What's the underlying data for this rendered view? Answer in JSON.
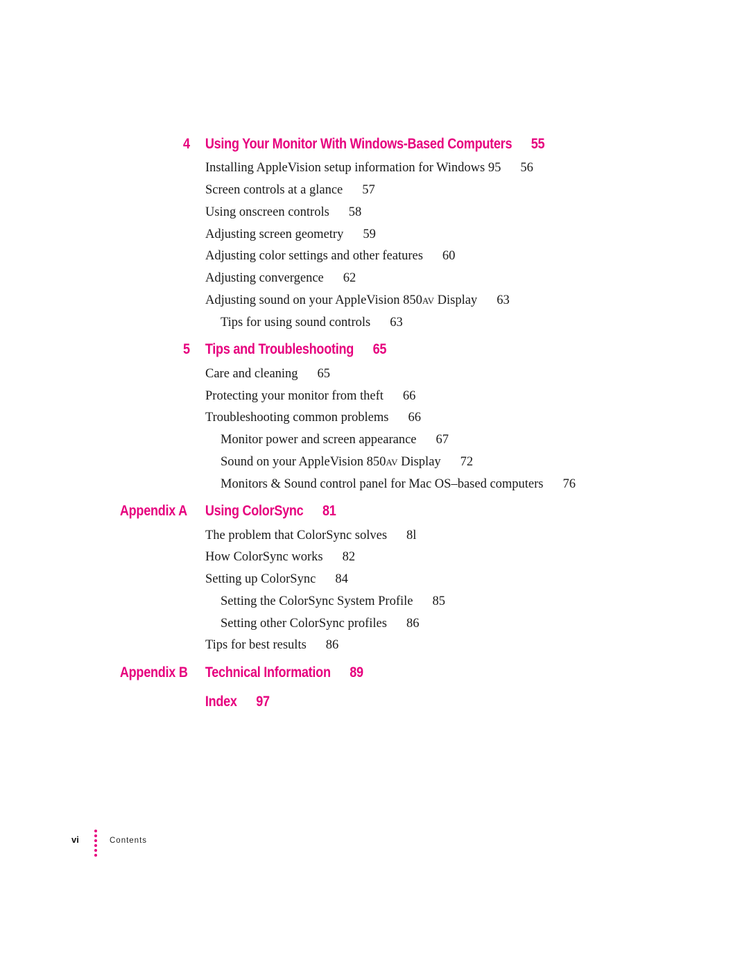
{
  "toc": {
    "ch4": {
      "number": "4",
      "title": "Using Your Monitor With Windows-Based Computers",
      "page": "55",
      "entries": [
        {
          "text": "Installing AppleVision setup information for Windows 95",
          "page": "56"
        },
        {
          "text": "Screen controls at a glance",
          "page": "57"
        },
        {
          "text": "Using onscreen controls",
          "page": "58"
        },
        {
          "text": "Adjusting screen geometry",
          "page": "59"
        },
        {
          "text": "Adjusting color settings and other features",
          "page": "60"
        },
        {
          "text": "Adjusting convergence",
          "page": "62"
        },
        {
          "text_before": "Adjusting sound on your AppleVision 850",
          "smallcaps": "AV",
          "text_after": " Display",
          "page": "63"
        },
        {
          "text": "Tips for using sound controls",
          "page": "63"
        }
      ]
    },
    "ch5": {
      "number": "5",
      "title": "Tips and Troubleshooting",
      "page": "65",
      "entries": [
        {
          "text": "Care and cleaning",
          "page": "65"
        },
        {
          "text": "Protecting your monitor from theft",
          "page": "66"
        },
        {
          "text": "Troubleshooting common problems",
          "page": "66"
        },
        {
          "text": "Monitor power and screen appearance",
          "page": "67"
        },
        {
          "text_before": "Sound on your AppleVision 850",
          "smallcaps": "AV",
          "text_after": " Display",
          "page": "72"
        },
        {
          "text": "Monitors & Sound control panel for Mac OS–based computers",
          "page": "76"
        }
      ]
    },
    "appA": {
      "number": "Appendix A",
      "title": "Using ColorSync",
      "page": "81",
      "entries": [
        {
          "text": "The problem that ColorSync solves",
          "page": "8l"
        },
        {
          "text": "How ColorSync works",
          "page": "82"
        },
        {
          "text": "Setting up ColorSync",
          "page": "84"
        },
        {
          "text": "Setting the ColorSync System Profile",
          "page": "85"
        },
        {
          "text": "Setting other ColorSync profiles",
          "page": "86"
        },
        {
          "text": "Tips for best results",
          "page": "86"
        }
      ]
    },
    "appB": {
      "number": "Appendix B",
      "title": "Technical Information",
      "page": "89"
    },
    "index": {
      "title": "Index",
      "page": "97"
    }
  },
  "footer": {
    "folio": "vi",
    "label": "Contents"
  },
  "colors": {
    "accent": "#e6007e",
    "text": "#1a1a1a"
  }
}
